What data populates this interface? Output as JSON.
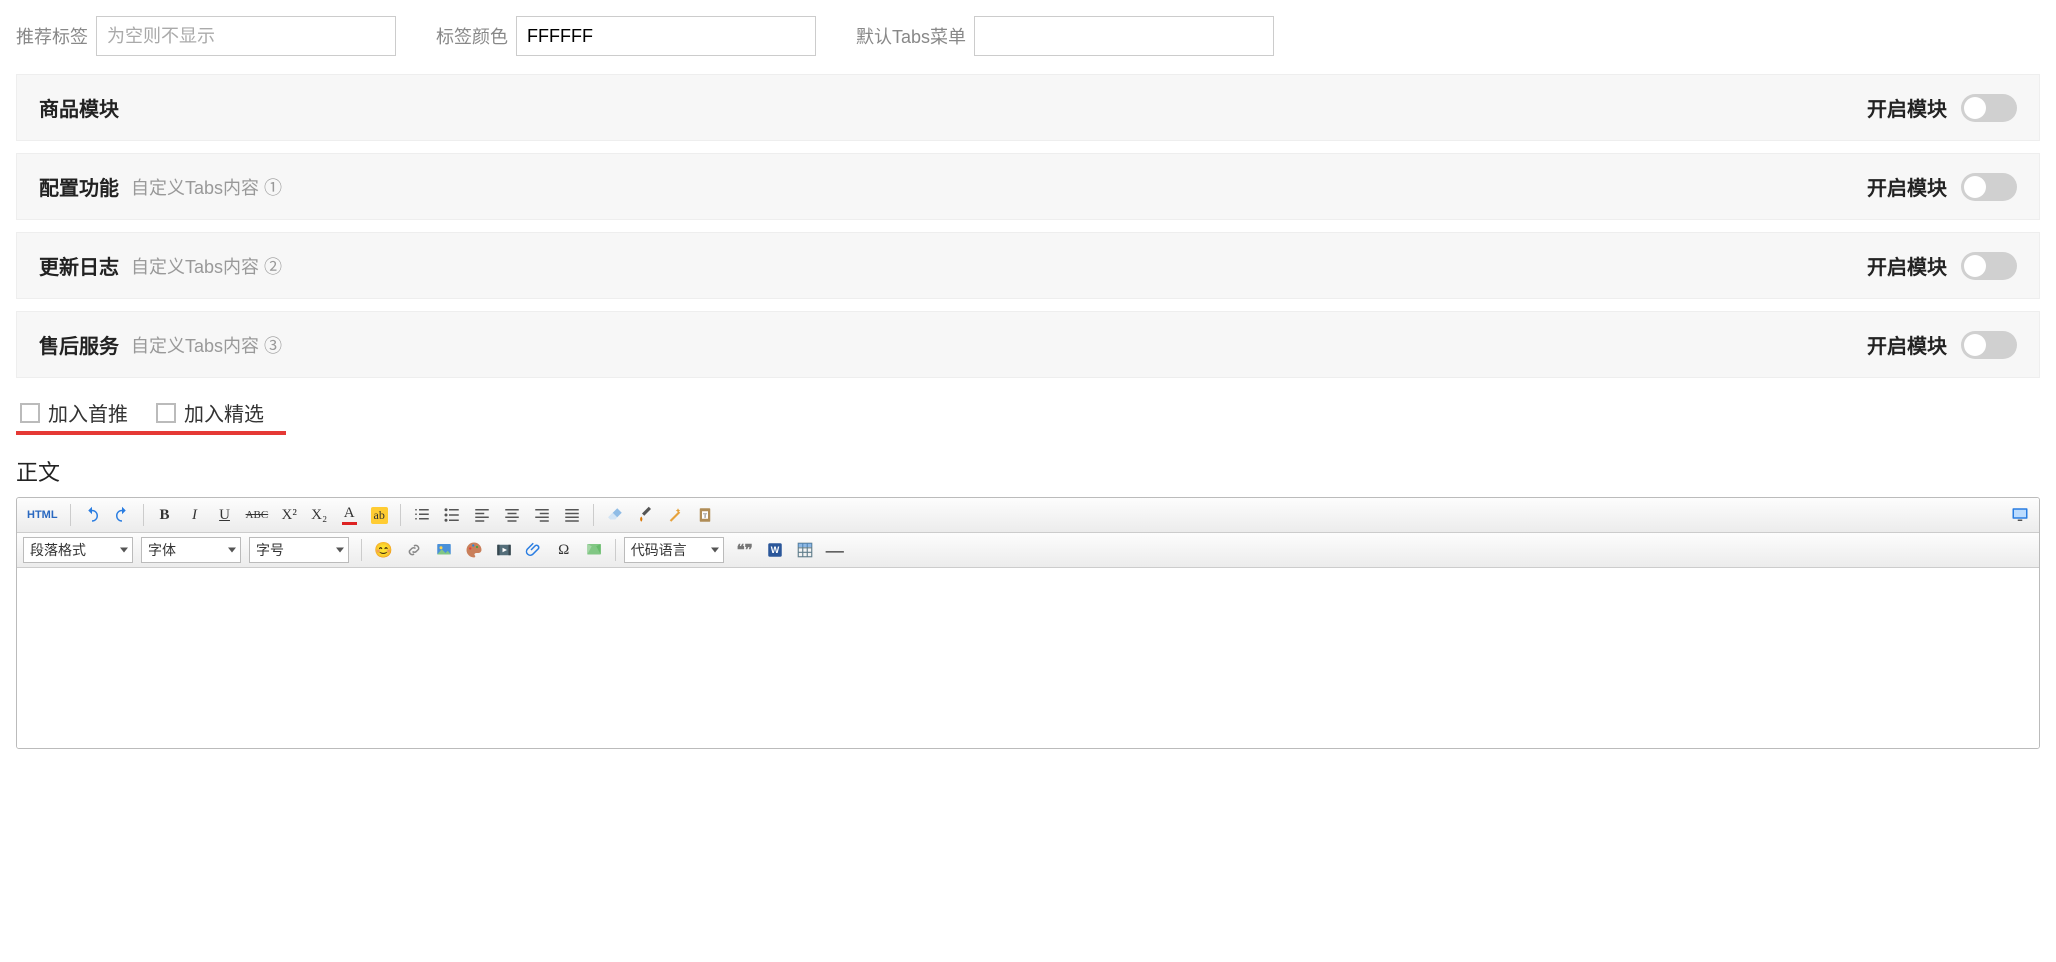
{
  "top": {
    "recommend_tag_label": "推荐标签",
    "recommend_tag_placeholder": "为空则不显示",
    "recommend_tag_value": "",
    "tag_color_label": "标签颜色",
    "tag_color_value": "FFFFFF",
    "default_tabs_label": "默认Tabs菜单",
    "default_tabs_value": ""
  },
  "panels": [
    {
      "title": "商品模块",
      "sub": "",
      "toggle_label": "开启模块"
    },
    {
      "title": "配置功能",
      "sub": "自定义Tabs内容 ①",
      "toggle_label": "开启模块"
    },
    {
      "title": "更新日志",
      "sub": "自定义Tabs内容 ②",
      "toggle_label": "开启模块"
    },
    {
      "title": "售后服务",
      "sub": "自定义Tabs内容 ③",
      "toggle_label": "开启模块"
    }
  ],
  "checks": {
    "featured": "加入首推",
    "selected": "加入精选"
  },
  "content_title": "正文",
  "editor": {
    "html_btn": "HTML",
    "format_select": "段落格式",
    "font_select": "字体",
    "size_select": "字号",
    "code_lang_select": "代码语言",
    "bold": "B",
    "italic": "I",
    "underline": "U",
    "strike": "ABC",
    "sup": "X²",
    "sub": "X₂",
    "font_color": "A",
    "highlight": "ab",
    "emoji": "😊",
    "link": "🔗",
    "image": "🖼",
    "palette": "🎨",
    "video": "🎬",
    "attachment": "📎",
    "omega": "Ω",
    "map": "🗺",
    "quote": "❝❞",
    "word": "W",
    "table": "⊞",
    "hr": "—"
  }
}
